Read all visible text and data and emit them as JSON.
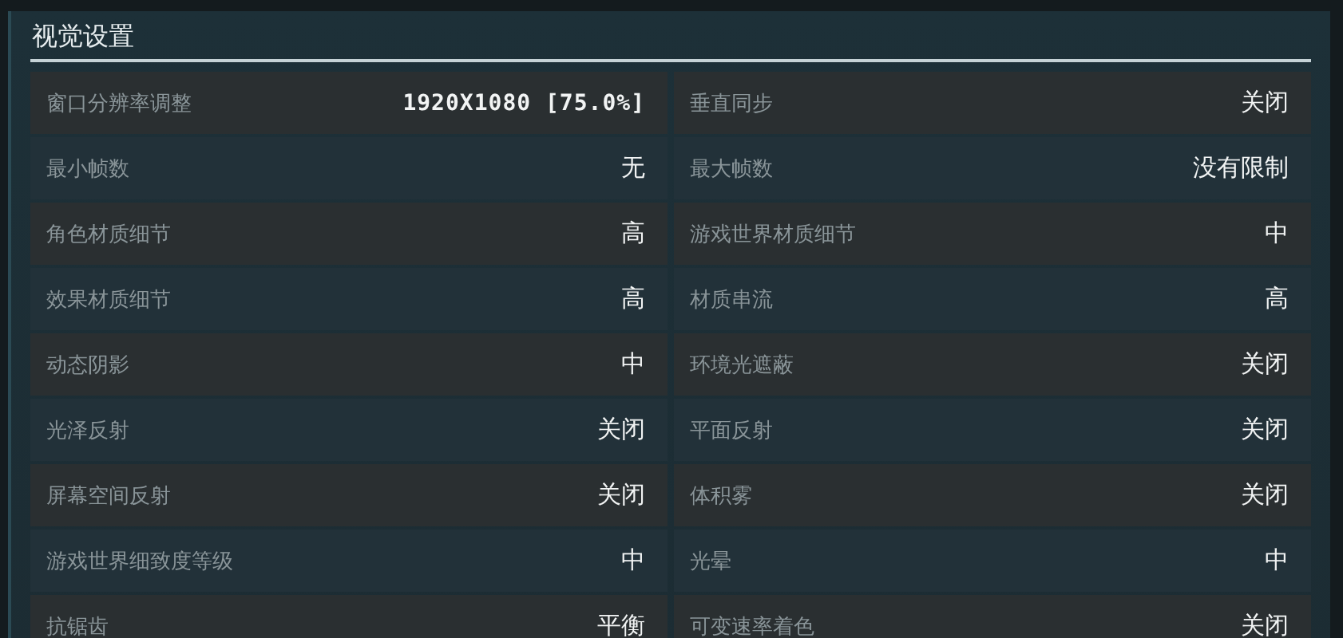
{
  "panel": {
    "title": "视觉设置"
  },
  "settings": [
    {
      "label": "窗口分辨率调整",
      "value": "1920X1080 [75.0%]",
      "kind": "numeric"
    },
    {
      "label": "垂直同步",
      "value": "关闭",
      "kind": "text"
    },
    {
      "label": "最小帧数",
      "value": "无",
      "kind": "text"
    },
    {
      "label": "最大帧数",
      "value": "没有限制",
      "kind": "text"
    },
    {
      "label": "角色材质细节",
      "value": "高",
      "kind": "text"
    },
    {
      "label": "游戏世界材质细节",
      "value": "中",
      "kind": "text"
    },
    {
      "label": "效果材质细节",
      "value": "高",
      "kind": "text"
    },
    {
      "label": "材质串流",
      "value": "高",
      "kind": "text"
    },
    {
      "label": "动态阴影",
      "value": "中",
      "kind": "text"
    },
    {
      "label": "环境光遮蔽",
      "value": "关闭",
      "kind": "text"
    },
    {
      "label": "光泽反射",
      "value": "关闭",
      "kind": "text"
    },
    {
      "label": "平面反射",
      "value": "关闭",
      "kind": "text"
    },
    {
      "label": "屏幕空间反射",
      "value": "关闭",
      "kind": "text"
    },
    {
      "label": "体积雾",
      "value": "关闭",
      "kind": "text"
    },
    {
      "label": "游戏世界细致度等级",
      "value": "中",
      "kind": "text"
    },
    {
      "label": "光晕",
      "value": "中",
      "kind": "text"
    },
    {
      "label": "抗锯齿",
      "value": "平衡",
      "kind": "text"
    },
    {
      "label": "可变速率着色",
      "value": "关闭",
      "kind": "text"
    }
  ]
}
